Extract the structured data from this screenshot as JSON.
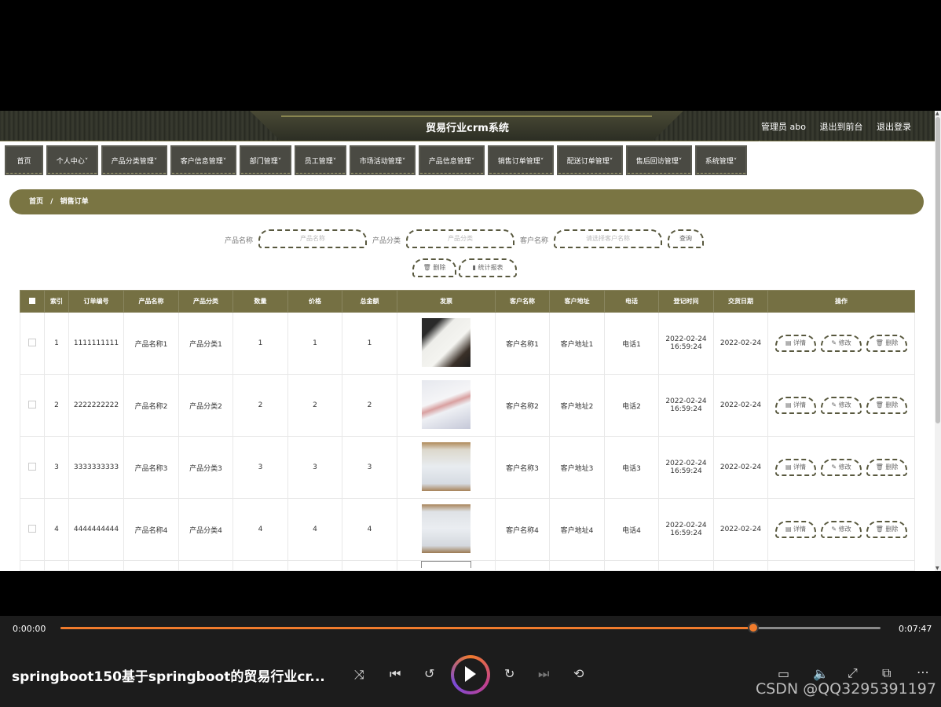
{
  "app": {
    "title": "贸易行业crm系统",
    "user": "管理员 abo",
    "to_front": "退出到前台",
    "logout": "退出登录"
  },
  "nav": [
    {
      "label": "首页"
    },
    {
      "label": "个人中心˅"
    },
    {
      "label": "产品分类管理˅"
    },
    {
      "label": "客户信息管理˅"
    },
    {
      "label": "部门管理˅"
    },
    {
      "label": "员工管理˅"
    },
    {
      "label": "市场活动管理˅"
    },
    {
      "label": "产品信息管理˅"
    },
    {
      "label": "销售订单管理˅"
    },
    {
      "label": "配送订单管理˅"
    },
    {
      "label": "售后回访管理˅"
    },
    {
      "label": "系统管理˅"
    }
  ],
  "breadcrumb": {
    "home": "首页",
    "sep": "/",
    "current": "销售订单"
  },
  "search": {
    "product_name_label": "产品名称",
    "product_name_placeholder": "产品名称",
    "product_cat_label": "产品分类",
    "product_cat_placeholder": "产品分类",
    "customer_label": "客户名称",
    "customer_placeholder": "请选择客户名称",
    "query_btn": "查询",
    "delete_btn": "删除",
    "report_btn": "统计报表"
  },
  "table": {
    "headers": [
      "",
      "索引",
      "订单编号",
      "产品名称",
      "产品分类",
      "数量",
      "价格",
      "总金额",
      "发票",
      "客户名称",
      "客户地址",
      "电话",
      "登记时间",
      "交货日期",
      "操作"
    ],
    "rows": [
      {
        "idx": "1",
        "order": "1111111111",
        "product": "产品名称1",
        "category": "产品分类1",
        "qty": "1",
        "price": "1",
        "total": "1",
        "customer": "客户名称1",
        "address": "客户地址1",
        "phone": "电话1",
        "reg_date": "2022-02-24",
        "reg_time": "16:59:24",
        "delivery": "2022-02-24"
      },
      {
        "idx": "2",
        "order": "2222222222",
        "product": "产品名称2",
        "category": "产品分类2",
        "qty": "2",
        "price": "2",
        "total": "2",
        "customer": "客户名称2",
        "address": "客户地址2",
        "phone": "电话2",
        "reg_date": "2022-02-24",
        "reg_time": "16:59:24",
        "delivery": "2022-02-24"
      },
      {
        "idx": "3",
        "order": "3333333333",
        "product": "产品名称3",
        "category": "产品分类3",
        "qty": "3",
        "price": "3",
        "total": "3",
        "customer": "客户名称3",
        "address": "客户地址3",
        "phone": "电话3",
        "reg_date": "2022-02-24",
        "reg_time": "16:59:24",
        "delivery": "2022-02-24"
      },
      {
        "idx": "4",
        "order": "4444444444",
        "product": "产品名称4",
        "category": "产品分类4",
        "qty": "4",
        "price": "4",
        "total": "4",
        "customer": "客户名称4",
        "address": "客户地址4",
        "phone": "电话4",
        "reg_date": "2022-02-24",
        "reg_time": "16:59:24",
        "delivery": "2022-02-24"
      }
    ],
    "ops": {
      "detail": "详情",
      "edit": "修改",
      "delete": "删除"
    }
  },
  "player": {
    "current_time": "0:00:00",
    "total_time": "0:07:47",
    "progress_fraction": 0.845,
    "title": "springboot150基于springboot的贸易行业cr...",
    "watermark": "CSDN @QQ3295391197",
    "accent": "#f07b2c"
  }
}
